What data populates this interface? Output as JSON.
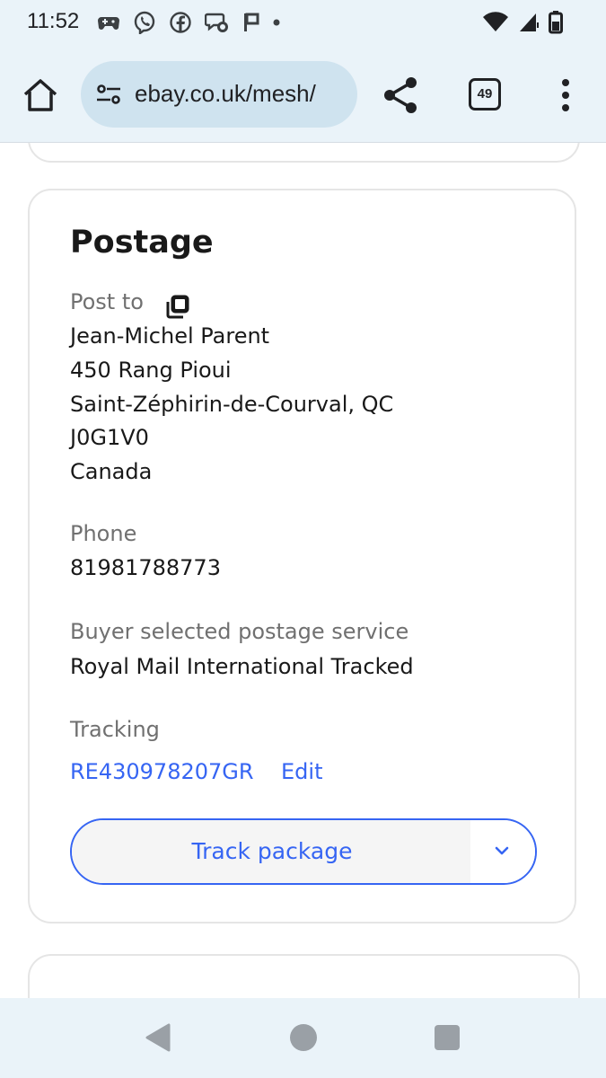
{
  "status_bar": {
    "time": "11:52",
    "left_icons": [
      "gamepad-icon",
      "viber-icon",
      "facebook-icon",
      "chat-icon",
      "flag-icon",
      "dot-icon"
    ],
    "right_icons": [
      "wifi-icon",
      "signal-icon",
      "battery-icon"
    ]
  },
  "browser": {
    "url": "ebay.co.uk/mesh/",
    "tab_count": "49",
    "icons": [
      "home-icon",
      "site-settings-icon",
      "share-icon",
      "tabs-icon",
      "more-vert-icon"
    ]
  },
  "postage": {
    "title": "Postage",
    "post_to_label": "Post to",
    "address": {
      "name": "Jean-Michel Parent",
      "street": "450 Rang Pioui",
      "city": "Saint-Zéphirin-de-Courval, QC",
      "postcode": "J0G1V0",
      "country": "Canada"
    },
    "phone_label": "Phone",
    "phone_value": "81981788773",
    "service_label": "Buyer selected postage service",
    "service_value": "Royal Mail International Tracked",
    "tracking_label": "Tracking",
    "tracking_number": "RE430978207GR",
    "edit_label": "Edit",
    "track_button_label": "Track package"
  },
  "colors": {
    "link": "#3665f3",
    "chrome_bg": "#eaf3f9",
    "url_pill": "#cfe3ef",
    "muted_text": "#707070"
  },
  "nav_bar": {
    "icons": [
      "back-icon",
      "home-circle-icon",
      "recents-icon"
    ]
  }
}
